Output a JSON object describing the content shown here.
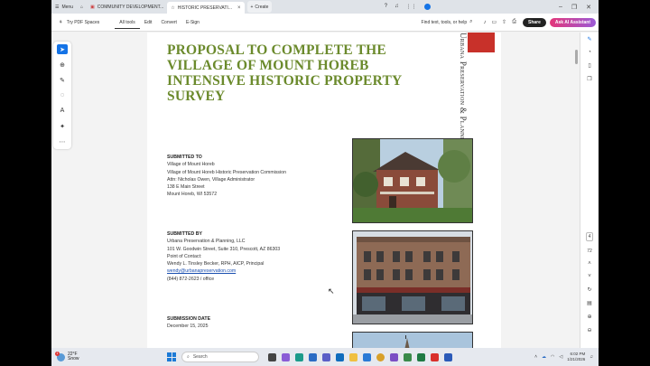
{
  "tabs": {
    "menu_label": "Menu",
    "tab1": "COMMUNITY DEVELOPMENT...",
    "tab2": "HISTORIC PRESERVATI...",
    "create": "Create"
  },
  "toolbar": {
    "spaces": "Try PDF Spaces",
    "all_tools": "All tools",
    "edit": "Edit",
    "convert": "Convert",
    "esign": "E-Sign",
    "search": "Find text, tools, or help",
    "share": "Share",
    "ai_assistant": "Ask AI Assistant"
  },
  "document": {
    "title": "PROPOSAL TO COMPLETE THE VILLAGE OF MOUNT HOREB INTENSIVE HISTORIC PROPERTY SURVEY",
    "logo_text": "Urbana Preservation & Planning",
    "submitted_to": {
      "heading": "SUBMITTED TO",
      "l1": "Village of Mount Horeb",
      "l2": "Village of Mount Horeb Historic Preservation Commission",
      "l3": "Attn: Nicholas Owen, Village Administrator",
      "l4": "138 E Main Street",
      "l5": "Mount Horeb, WI 53572"
    },
    "submitted_by": {
      "heading": "SUBMITTED BY",
      "l1": "Urbana Preservation & Planning, LLC",
      "l2": "101 W. Goodwin Street, Suite 310, Prescott, AZ 86303",
      "l3": "Point of Contact:",
      "l4": "Wendy L. Tinsley Becker, RPH, AICP, Principal",
      "email": "wendy@urbanapreservation.com",
      "phone": "(844) 872-2623 / office"
    },
    "submission_date": {
      "heading": "SUBMISSION DATE",
      "date": "December 15, 2025"
    }
  },
  "sidebar": {
    "page_number": "4",
    "total_pages": "72"
  },
  "taskbar": {
    "temp": "22°F",
    "condition": "Snow",
    "badge": "1",
    "search": "Search",
    "time": "6:02 PM",
    "date": "1/21/2026"
  },
  "colors": {
    "title_green": "#6b8a2c",
    "logo_red": "#c8312a",
    "accent_blue": "#1473e6"
  }
}
